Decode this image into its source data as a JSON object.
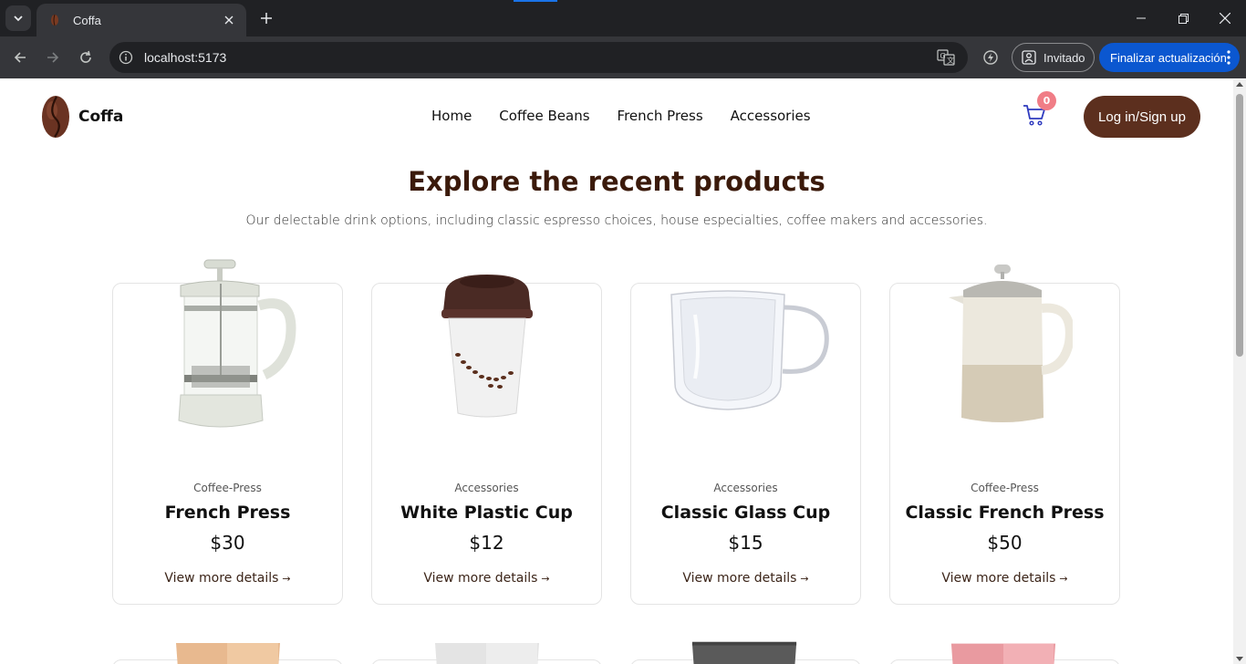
{
  "browser": {
    "tab_title": "Coffa",
    "url": "localhost:5173",
    "guest_label": "Invitado",
    "update_label": "Finalizar actualización"
  },
  "header": {
    "brand": "Coffa",
    "nav": [
      "Home",
      "Coffee Beans",
      "French Press",
      "Accessories"
    ],
    "cart_count": "0",
    "login_label": "Log in/Sign up"
  },
  "hero": {
    "title": "Explore the recent products",
    "subtitle": "Our delectable drink options, including classic espresso choices, house especialties, coffee makers and accessories."
  },
  "products": [
    {
      "category": "Coffee-Press",
      "name": "French Press",
      "price": "$30",
      "link": "View more details"
    },
    {
      "category": "Accessories",
      "name": "White Plastic Cup",
      "price": "$12",
      "link": "View more details"
    },
    {
      "category": "Accessories",
      "name": "Classic Glass Cup",
      "price": "$15",
      "link": "View more details"
    },
    {
      "category": "Coffee-Press",
      "name": "Classic French Press",
      "price": "$50",
      "link": "View more details"
    }
  ],
  "colors": {
    "brand_brown": "#5c2f1e",
    "title_brown": "#3b1a0b",
    "badge_pink": "#f07d86",
    "update_blue": "#0b57d0"
  },
  "icons": [
    "coffee-bean-icon",
    "cart-icon",
    "translate-icon",
    "guest-profile-icon",
    "arrow-right-icon"
  ]
}
